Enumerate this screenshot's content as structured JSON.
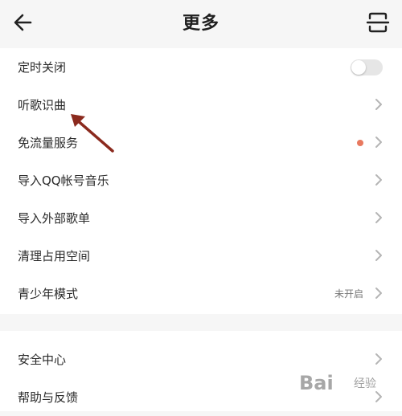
{
  "header": {
    "title": "更多",
    "back_icon": "back-arrow-icon",
    "scan_icon": "scan-icon"
  },
  "settings": [
    {
      "label": "定时关闭",
      "control": "toggle",
      "toggle_on": false
    },
    {
      "label": "听歌识曲",
      "control": "chevron"
    },
    {
      "label": "免流量服务",
      "control": "chevron",
      "badge": "red-dot"
    },
    {
      "label": "导入QQ帐号音乐",
      "control": "chevron"
    },
    {
      "label": "导入外部歌单",
      "control": "chevron"
    },
    {
      "label": "清理占用空间",
      "control": "chevron"
    },
    {
      "label": "青少年模式",
      "control": "chevron",
      "status": "未开启"
    }
  ],
  "settings2": [
    {
      "label": "安全中心",
      "control": "chevron"
    },
    {
      "label": "帮助与反馈",
      "control": "chevron"
    }
  ],
  "overlay": {
    "annotation_arrow_color": "#8b2a1e"
  },
  "watermark": {
    "text": "Bai",
    "sub": "经验"
  },
  "colors": {
    "background": "#f6f6f6",
    "card": "#ffffff",
    "dot": "#e8795f",
    "toggle_track": "#e6e6e6"
  }
}
